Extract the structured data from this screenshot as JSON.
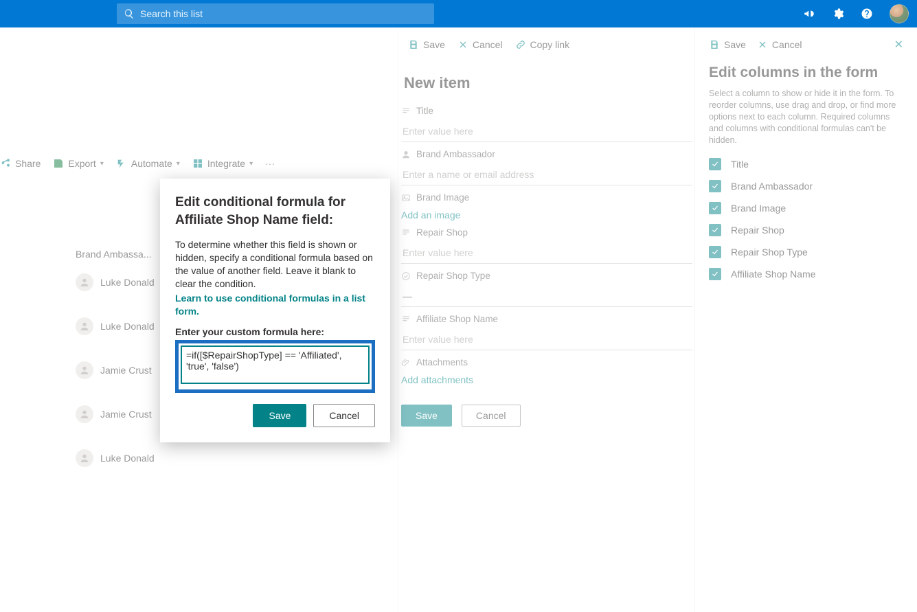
{
  "suite": {
    "search_placeholder": "Search this list"
  },
  "commands": {
    "share": "Share",
    "export": "Export",
    "automate": "Automate",
    "integrate": "Integrate"
  },
  "list": {
    "column_header": "Brand Ambassa...",
    "rows": [
      "Luke Donald",
      "Luke Donald",
      "Jamie Crust",
      "Jamie Crust",
      "Luke Donald"
    ]
  },
  "form_panel": {
    "save": "Save",
    "cancel": "Cancel",
    "copy_link": "Copy link",
    "title": "New item",
    "fields": {
      "title_label": "Title",
      "title_placeholder": "Enter value here",
      "ba_label": "Brand Ambassador",
      "ba_placeholder": "Enter a name or email address",
      "bi_label": "Brand Image",
      "bi_add": "Add an image",
      "rs_label": "Repair Shop",
      "rs_placeholder": "Enter value here",
      "rst_label": "Repair Shop Type",
      "rst_value": "—",
      "asn_label": "Affiliate Shop Name",
      "asn_placeholder": "Enter value here",
      "att_label": "Attachments",
      "att_add": "Add attachments"
    },
    "btn_save": "Save",
    "btn_cancel": "Cancel"
  },
  "cols_panel": {
    "save": "Save",
    "cancel": "Cancel",
    "title": "Edit columns in the form",
    "desc": "Select a column to show or hide it in the form. To reorder columns, use drag and drop, or find more options next to each column. Required columns and columns with conditional formulas can't be hidden.",
    "items": [
      "Title",
      "Brand Ambassador",
      "Brand Image",
      "Repair Shop",
      "Repair Shop Type",
      "Affiliate Shop Name"
    ]
  },
  "modal": {
    "heading": "Edit conditional formula for Affiliate Shop Name field:",
    "desc": "To determine whether this field is shown or hidden, specify a conditional formula based on the value of another field. Leave it blank to clear the condition.",
    "learn": "Learn to use conditional formulas in a list form.",
    "formula_label": "Enter your custom formula here:",
    "formula_value": "=if([$RepairShopType] == 'Affiliated', 'true', 'false')",
    "save": "Save",
    "cancel": "Cancel"
  }
}
